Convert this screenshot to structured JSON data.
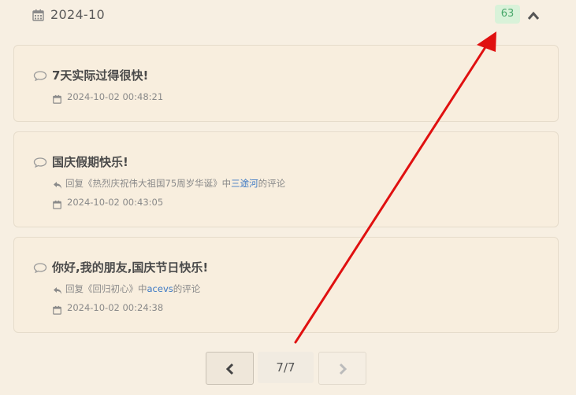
{
  "month": {
    "title": "2024-10",
    "count": "63"
  },
  "comments": [
    {
      "title": "7天实际过得很快!",
      "timestamp": "2024-10-02 00:48:21"
    },
    {
      "title": "国庆假期快乐!",
      "reply_prefix": "回复《热烈庆祝伟大祖国75周岁华诞》中",
      "reply_user": "三途河",
      "reply_suffix": "的评论",
      "timestamp": "2024-10-02 00:43:05"
    },
    {
      "title": "你好,我的朋友,国庆节日快乐!",
      "reply_prefix": "回复《回归初心》中",
      "reply_user": "acevs",
      "reply_suffix": "的评论",
      "timestamp": "2024-10-02 00:24:38"
    }
  ],
  "pagination": {
    "current": "7/7"
  },
  "colors": {
    "background": "#f7efe2",
    "badge_bg": "#d9f2d9",
    "badge_text": "#4aa86b",
    "link": "#3b78c4",
    "annotation_arrow": "#e01010"
  }
}
